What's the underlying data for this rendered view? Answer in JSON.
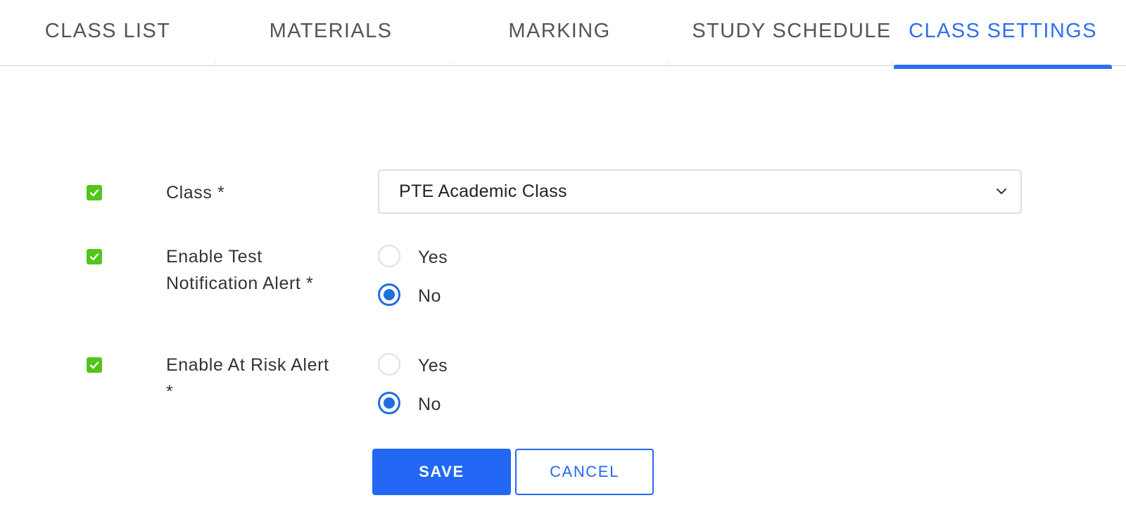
{
  "tabs": [
    {
      "label": "CLASS LIST",
      "active": false
    },
    {
      "label": "MATERIALS",
      "active": false
    },
    {
      "label": "MARKING",
      "active": false
    },
    {
      "label": "STUDY SCHEDULE",
      "active": false
    },
    {
      "label": "CLASS SETTINGS",
      "active": true
    }
  ],
  "form": {
    "class_field": {
      "enabled": true,
      "label": "Class *",
      "selected": "PTE Academic Class"
    },
    "test_notification": {
      "enabled": true,
      "label_line1": "Enable Test",
      "label_line2": "Notification Alert *",
      "options": [
        "Yes",
        "No"
      ],
      "selected": "No"
    },
    "at_risk": {
      "enabled": true,
      "label_line1": "Enable At Risk Alert",
      "label_line2": "*",
      "options": [
        "Yes",
        "No"
      ],
      "selected": "No"
    }
  },
  "buttons": {
    "save": "SAVE",
    "cancel": "CANCEL"
  },
  "colors": {
    "accent": "#2d6ff2",
    "checkbox": "#52c41a",
    "radio_selected": "#1e6fe0"
  },
  "icons": {
    "checkbox": "check-icon",
    "select": "chevron-down-icon"
  }
}
